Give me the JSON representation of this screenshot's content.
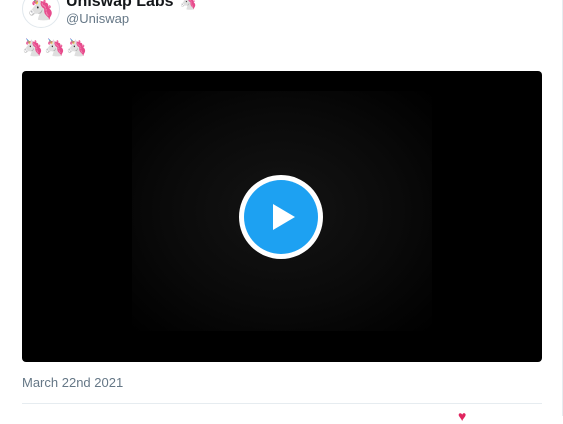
{
  "tweet": {
    "display_name": "Uniswap Labs",
    "name_emoji": "🦄",
    "handle": "@Uniswap",
    "avatar_emoji": "🦄",
    "emojis": "🦄🦄🦄",
    "date": "March 22nd 2021"
  },
  "colors": {
    "accent": "#1da1f2",
    "text_primary": "#14171a",
    "text_secondary": "#657786"
  },
  "icons": {
    "play": "play-icon",
    "like": "heart-icon"
  }
}
